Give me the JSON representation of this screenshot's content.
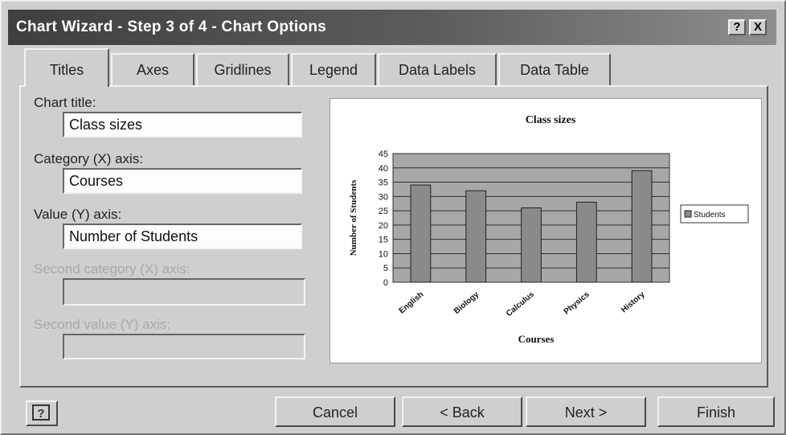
{
  "window": {
    "title": "Chart Wizard - Step 3 of 4 - Chart Options",
    "help_glyph": "?",
    "close_glyph": "X"
  },
  "tabs": [
    {
      "label": "Titles",
      "active": true
    },
    {
      "label": "Axes",
      "active": false
    },
    {
      "label": "Gridlines",
      "active": false
    },
    {
      "label": "Legend",
      "active": false
    },
    {
      "label": "Data Labels",
      "active": false
    },
    {
      "label": "Data Table",
      "active": false
    }
  ],
  "form": {
    "chart_title": {
      "label": "Chart title:",
      "value": "Class sizes",
      "enabled": true
    },
    "category_axis": {
      "label": "Category (X) axis:",
      "value": "Courses",
      "enabled": true
    },
    "value_axis": {
      "label": "Value (Y) axis:",
      "value": "Number of Students",
      "enabled": true
    },
    "second_category_axis": {
      "label": "Second category (X) axis:",
      "value": "",
      "enabled": false
    },
    "second_value_axis": {
      "label": "Second value (Y) axis:",
      "value": "",
      "enabled": false
    }
  },
  "buttons": {
    "help_icon": "help-icon",
    "cancel": "Cancel",
    "back": "< Back",
    "next": "Next >",
    "finish": "Finish"
  },
  "colors": {
    "titlebar_start": "#3f3f3f",
    "titlebar_end": "#8e8e8e",
    "face": "#cfcfcf",
    "bar": "#8a8a8a",
    "plot_bg": "#a7a7a7"
  },
  "chart_data": {
    "type": "bar",
    "title": "Class sizes",
    "xlabel": "Courses",
    "ylabel": "Number of Students",
    "categories": [
      "English",
      "Biology",
      "Calculus",
      "Physics",
      "History"
    ],
    "series": [
      {
        "name": "Students",
        "values": [
          34,
          32,
          26,
          28,
          39
        ]
      }
    ],
    "ylim": [
      0,
      45
    ],
    "yticks": [
      "0",
      "5",
      "10",
      "15",
      "20",
      "25",
      "30",
      "35",
      "40",
      "45"
    ],
    "grid": true,
    "legend": "right"
  }
}
